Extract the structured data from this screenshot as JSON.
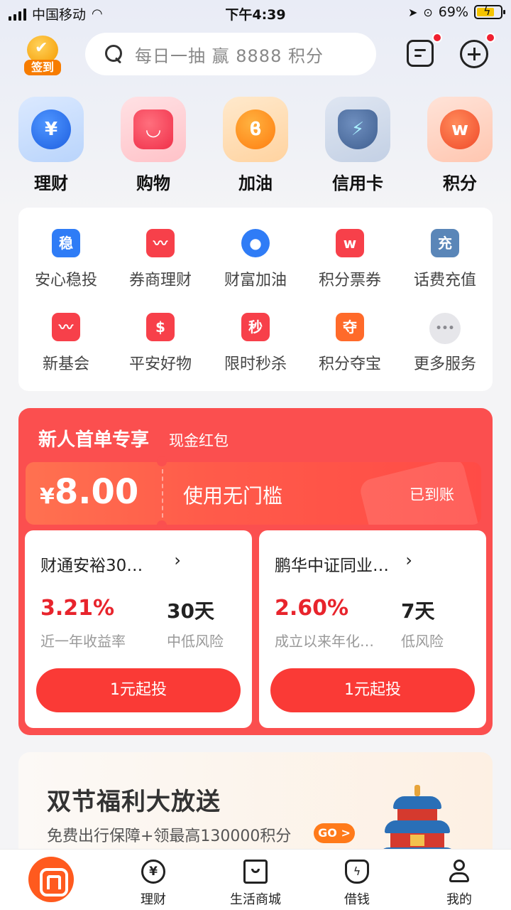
{
  "status_bar": {
    "carrier": "中国移动",
    "time": "下午4:39",
    "battery": "69%"
  },
  "header": {
    "checkin_label": "签到",
    "search_placeholder": "每日一抽 赢 8888 积分"
  },
  "categories": [
    {
      "label": "理财",
      "icon": "yuan-coin-icon",
      "symbol": "¥"
    },
    {
      "label": "购物",
      "icon": "shopping-bag-icon",
      "symbol": "◡"
    },
    {
      "label": "加油",
      "icon": "fuel-icon",
      "symbol": "ϐ"
    },
    {
      "label": "信用卡",
      "icon": "shield-bolt-icon",
      "symbol": "⚡"
    },
    {
      "label": "积分",
      "icon": "points-icon",
      "symbol": "w"
    }
  ],
  "services": [
    {
      "label": "安心稳投",
      "icon": "stable-invest-icon",
      "glyph": "稳"
    },
    {
      "label": "券商理财",
      "icon": "broker-trend-icon",
      "glyph": "〰"
    },
    {
      "label": "财富加油",
      "icon": "wealth-boost-icon",
      "glyph": "●"
    },
    {
      "label": "积分票券",
      "icon": "ticket-icon",
      "glyph": "w"
    },
    {
      "label": "话费充值",
      "icon": "phone-recharge-icon",
      "glyph": "充"
    },
    {
      "label": "新基会",
      "icon": "gift-icon",
      "glyph": "〰"
    },
    {
      "label": "平安好物",
      "icon": "goods-bag-icon",
      "glyph": "$"
    },
    {
      "label": "限时秒杀",
      "icon": "flash-sale-icon",
      "glyph": "秒"
    },
    {
      "label": "积分夺宝",
      "icon": "treasure-icon",
      "glyph": "夺"
    },
    {
      "label": "更多服务",
      "icon": "more-dots-icon",
      "glyph": "•••"
    }
  ],
  "promo": {
    "title": "新人首单专享",
    "subtitle": "现金红包",
    "coupon": {
      "currency": "¥",
      "amount": "8.00",
      "description": "使用无门槛",
      "status": "已到账"
    },
    "funds": [
      {
        "name": "财通安裕30…",
        "rate": "3.21%",
        "rate_label": "近一年收益率",
        "term": "30天",
        "risk": "中低风险",
        "button": "1元起投"
      },
      {
        "name": "鹏华中证同业…",
        "rate": "2.60%",
        "rate_label": "成立以来年化…",
        "term": "7天",
        "risk": "低风险",
        "button": "1元起投"
      }
    ]
  },
  "banner": {
    "title": "双节福利大放送",
    "subtitle": "免费出行保障+领最高130000积分",
    "go_label": "GO >"
  },
  "tabbar": {
    "items": [
      {
        "label": "理财",
        "icon": "yuan-circle-icon"
      },
      {
        "label": "生活商城",
        "icon": "store-bag-icon"
      },
      {
        "label": "借钱",
        "icon": "loan-shield-icon"
      },
      {
        "label": "我的",
        "icon": "profile-icon"
      }
    ]
  },
  "colors": {
    "accent_red": "#fb4f4f",
    "button_red": "#fa3a36",
    "rate_red": "#e8242c",
    "home_orange": "#ff5a1e"
  }
}
